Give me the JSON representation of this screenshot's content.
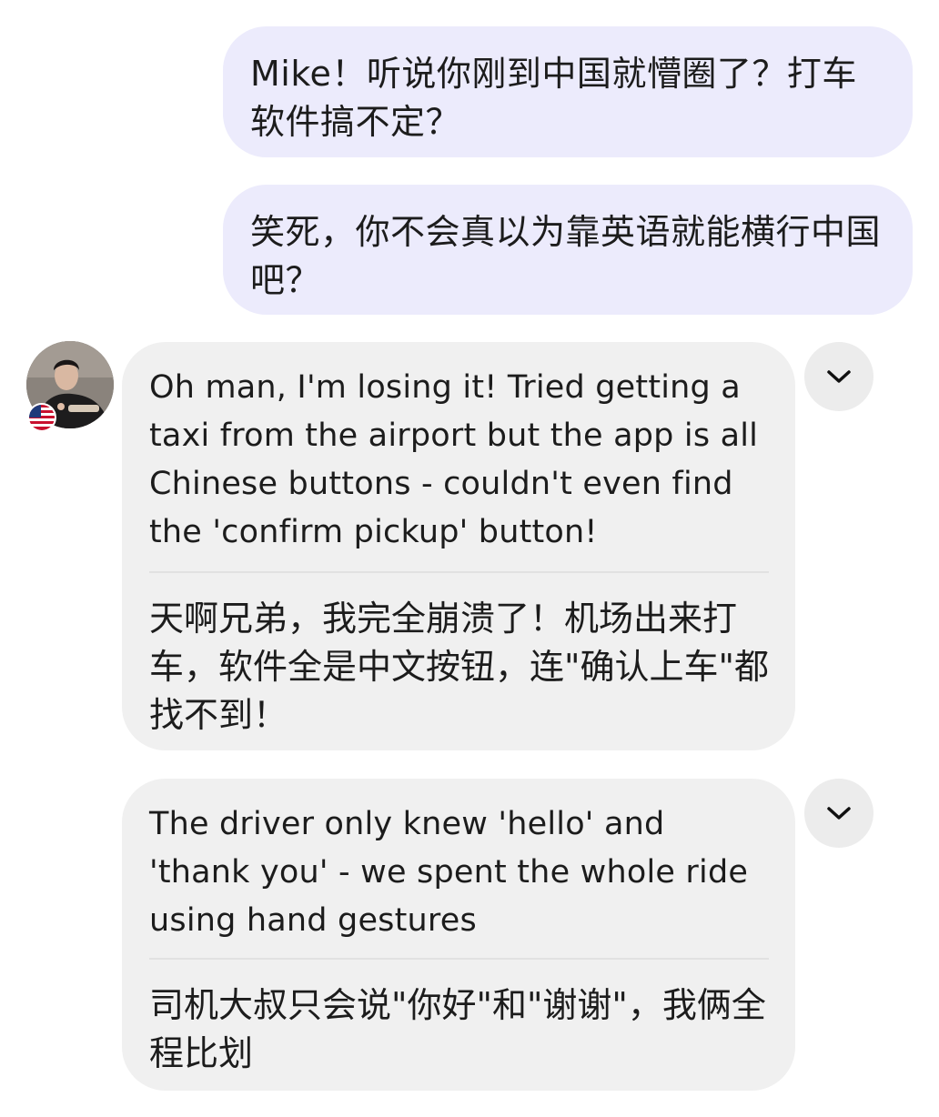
{
  "messages": {
    "outgoing": [
      {
        "text": "Mike！听说你刚到中国就懵圈了？打车软件搞不定？"
      },
      {
        "text": "笑死，你不会真以为靠英语就能横行中国吧？"
      }
    ],
    "incoming": [
      {
        "original": "Oh man, I'm losing it! Tried getting a taxi from the airport but the app is all Chinese buttons - couldn't even find the 'confirm pickup' button!",
        "translation": "天啊兄弟，我完全崩溃了！机场出来打车，软件全是中文按钮，连\"确认上车\"都找不到！"
      },
      {
        "original": "The driver only knew 'hello' and 'thank you' - we spent the whole ride using hand gestures",
        "translation": "司机大叔只会说\"你好\"和\"谢谢\"，我俩全程比划"
      }
    ]
  },
  "contact": {
    "avatar_icon": "user-photo",
    "flag_icon": "us-flag-icon"
  },
  "colors": {
    "outgoing_bubble": "#ecebfc",
    "incoming_bubble": "#f0f0f0",
    "text": "#1c1c1c",
    "divider": "#e1e1e1",
    "chevron_button": "#ececec"
  }
}
